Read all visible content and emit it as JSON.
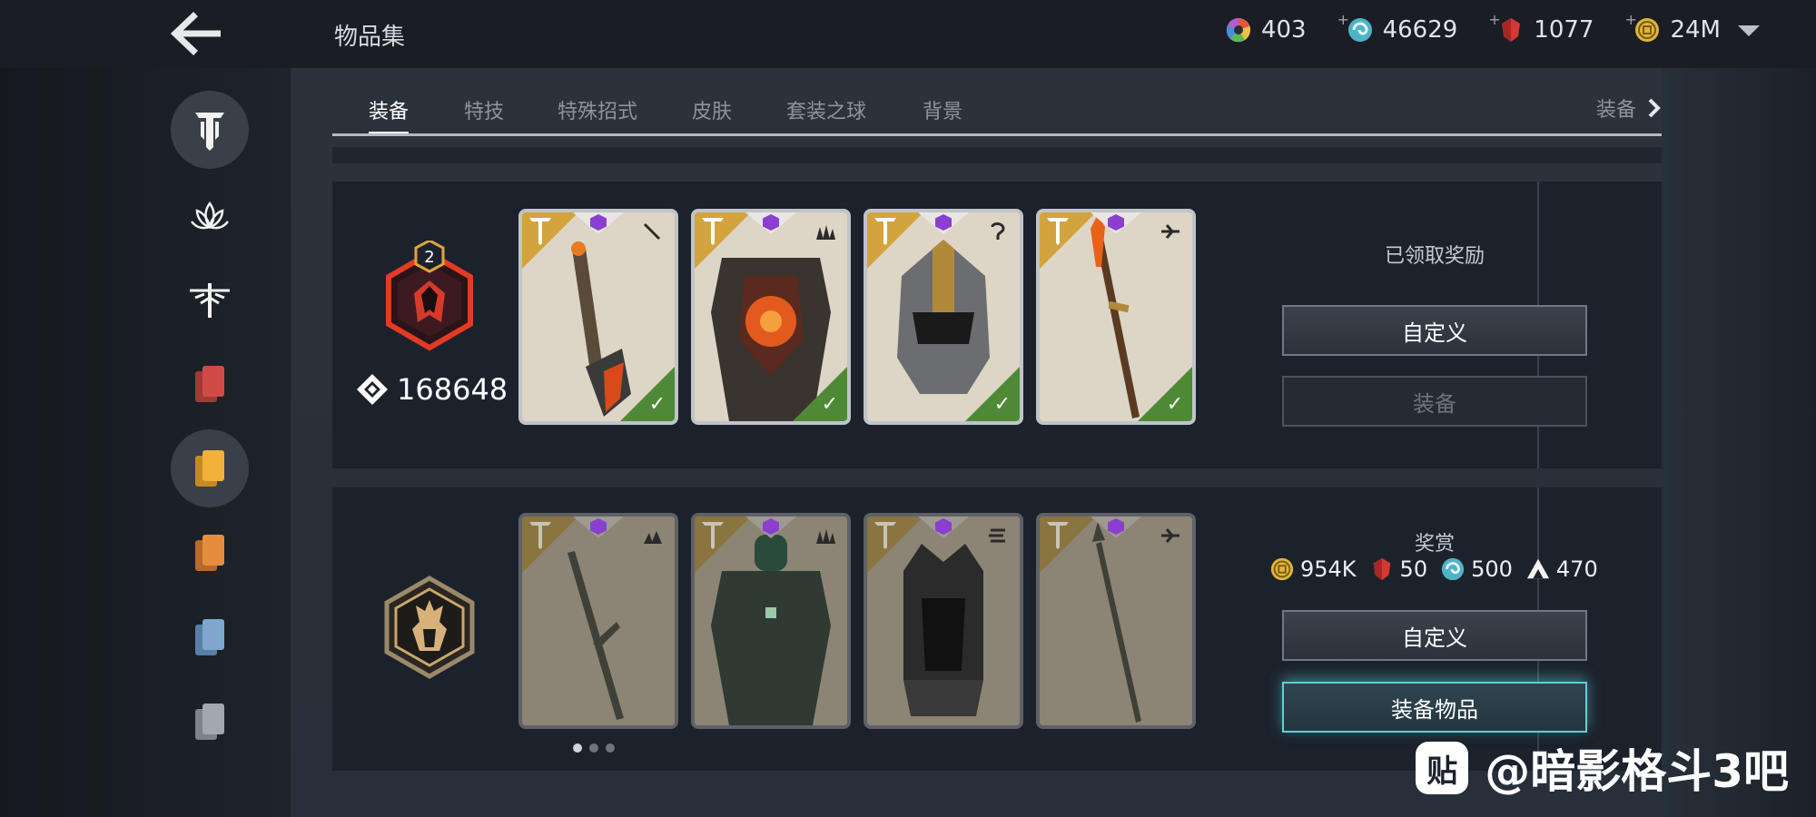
{
  "header": {
    "title": "物品集",
    "back_icon": "arrow-left-icon",
    "currencies": [
      {
        "name": "color-orb",
        "icon": "color-wheel-icon",
        "value": "403",
        "has_plus": false
      },
      {
        "name": "energy",
        "icon": "swirl-icon",
        "value": "46629",
        "has_plus": true
      },
      {
        "name": "ruby",
        "icon": "ruby-gem-icon",
        "value": "1077",
        "has_plus": true
      },
      {
        "name": "gold",
        "icon": "coin-icon",
        "value": "24M",
        "has_plus": true
      }
    ]
  },
  "sidebar": {
    "items": [
      {
        "icon": "legion-emblem-icon",
        "active": true
      },
      {
        "icon": "lotus-icon",
        "active": false
      },
      {
        "icon": "dynasty-icon",
        "active": false
      },
      {
        "icon": "red-cards-icon",
        "color": "#d14a47",
        "active": false
      },
      {
        "icon": "yellow-cards-icon",
        "color": "#f2b13a",
        "active": true
      },
      {
        "icon": "orange-cards-icon",
        "color": "#e58d3c",
        "active": false
      },
      {
        "icon": "blue-cards-icon",
        "color": "#7fa6cf",
        "active": false
      },
      {
        "icon": "gray-cards-icon",
        "color": "#a2a8ae",
        "active": false
      }
    ]
  },
  "tabs": {
    "items": [
      "装备",
      "特技",
      "特殊招式",
      "皮肤",
      "套装之球",
      "背景"
    ],
    "active": 0,
    "more_label": "装备"
  },
  "sets": [
    {
      "level": "2",
      "score": "168648",
      "status": "已领取奖励",
      "customize_label": "自定义",
      "equip_label": "装备",
      "equip_disabled": true,
      "cards": [
        {
          "item": "sword",
          "owned": true
        },
        {
          "item": "armor",
          "owned": true
        },
        {
          "item": "helmet",
          "owned": true
        },
        {
          "item": "spear",
          "owned": true
        }
      ]
    },
    {
      "reward_title": "奖赏",
      "rewards": [
        {
          "icon": "coin-icon",
          "value": "954K"
        },
        {
          "icon": "ruby-gem-icon",
          "value": "50"
        },
        {
          "icon": "swirl-icon",
          "value": "500"
        },
        {
          "icon": "triforce-icon",
          "value": "470"
        }
      ],
      "customize_label": "自定义",
      "equip_label": "装备物品",
      "cards": [
        {
          "item": "sword",
          "owned": false
        },
        {
          "item": "armor",
          "owned": false
        },
        {
          "item": "helmet",
          "owned": false
        },
        {
          "item": "spear",
          "owned": false
        }
      ],
      "pagination": {
        "count": 3,
        "active": 0
      }
    }
  ],
  "watermark": {
    "logo": "贴",
    "text": "@暗影格斗3吧"
  },
  "colors": {
    "gold_corner": "#d3a43e",
    "check_green": "#4e8a35",
    "rarity_purple": "#8a3fd1",
    "glow_cyan": "#5fd0d6"
  }
}
